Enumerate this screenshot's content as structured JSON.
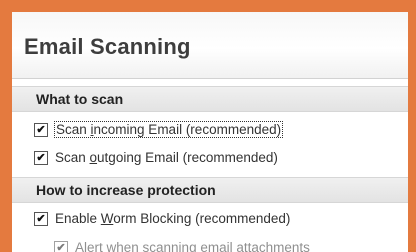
{
  "title": "Email Scanning",
  "sections": [
    {
      "label": "What to scan"
    },
    {
      "label": "How to increase protection"
    }
  ],
  "options": {
    "scan_incoming": {
      "pre": "Scan ",
      "key": "i",
      "post": "ncoming Email (recommended)",
      "checked": true,
      "check": "✔"
    },
    "scan_outgoing": {
      "pre": "Scan ",
      "key": "o",
      "post": "utgoing Email (recommended)",
      "checked": true,
      "check": "✔"
    },
    "worm_blocking": {
      "pre": "Enable ",
      "key": "W",
      "post": "orm Blocking (recommended)",
      "checked": true,
      "check": "✔"
    },
    "alert_attachments": {
      "text": "Alert when scanning email attachments",
      "checked": true,
      "check": "✔"
    }
  }
}
